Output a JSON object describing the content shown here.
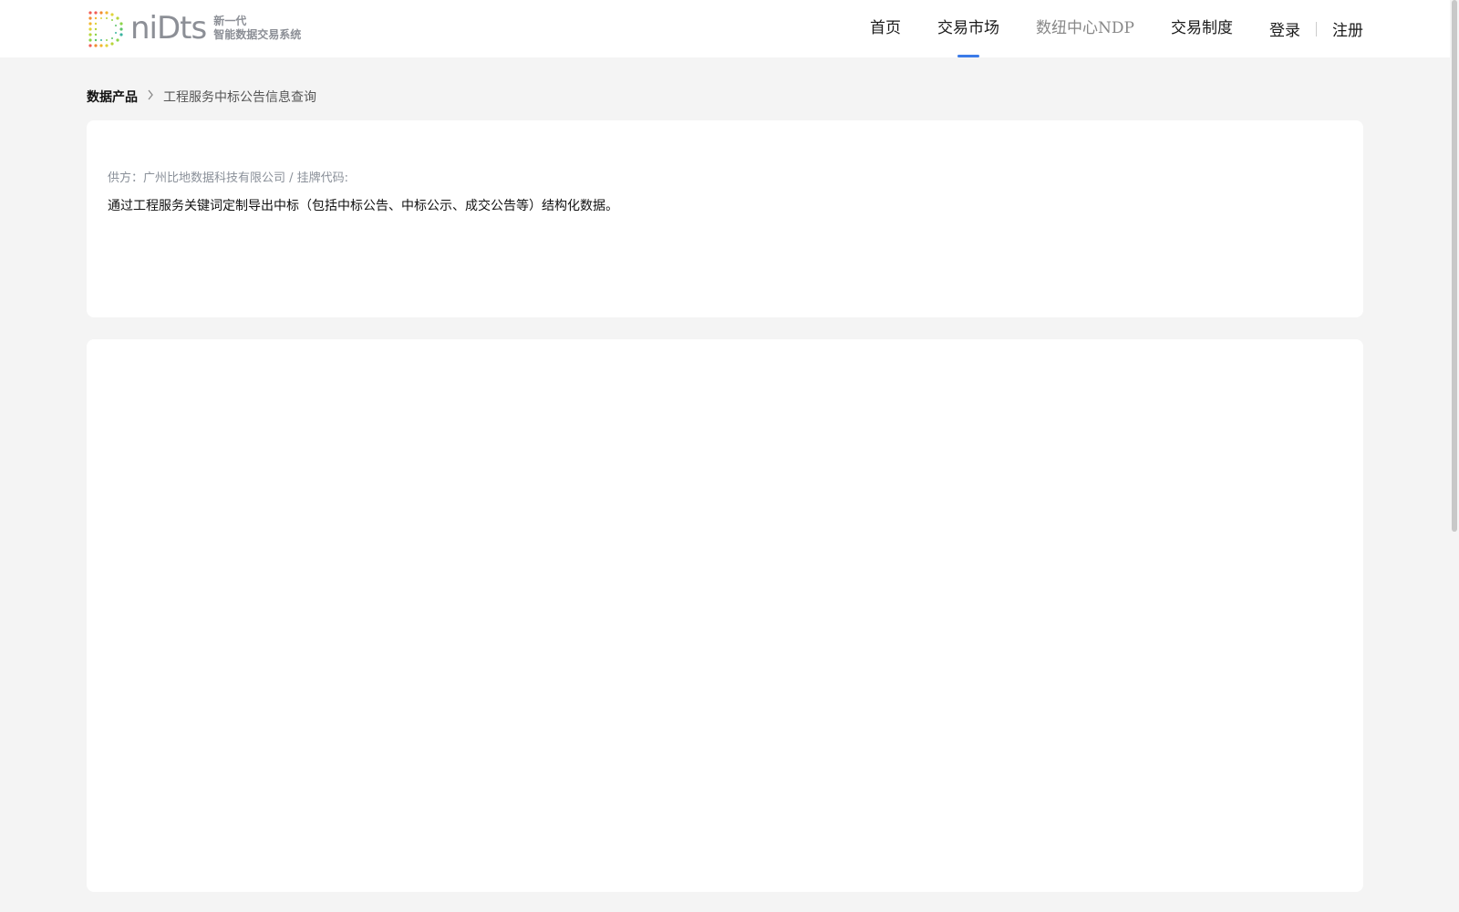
{
  "header": {
    "logo": {
      "word": "niDts",
      "tag_line1": "新一代",
      "tag_line2": "智能数据交易系统"
    },
    "nav": [
      {
        "label": "首页"
      },
      {
        "label": "交易市场",
        "active": true
      },
      {
        "label": "数纽中心NDP"
      },
      {
        "label": "交易制度"
      }
    ],
    "auth": {
      "login": "登录",
      "register": "注册"
    }
  },
  "breadcrumb": {
    "root": "数据产品",
    "separator_icon": "chevron-right-icon",
    "current": "工程服务中标公告信息查询"
  },
  "product": {
    "provider_line": "供方：广州比地数据科技有限公司 / 挂牌代码:",
    "description": "通过工程服务关键词定制导出中标（包括中标公告、中标公示、成交公告等）结构化数据。"
  },
  "colors": {
    "accent": "#3b7be8",
    "background": "#f4f4f4",
    "card": "#ffffff",
    "logo_gray": "#8c8f96"
  }
}
